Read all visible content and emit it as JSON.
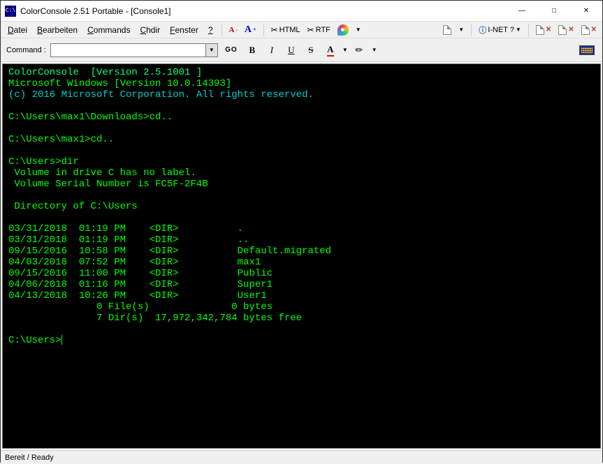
{
  "window": {
    "title": "ColorConsole 2.51 Portable - [Console1]",
    "icon_text": "C:\\"
  },
  "menubar": {
    "items": [
      {
        "label": "Datei",
        "accel": 0
      },
      {
        "label": "Bearbeiten",
        "accel": 0
      },
      {
        "label": "Commands",
        "accel": 0
      },
      {
        "label": "Chdir",
        "accel": 0
      },
      {
        "label": "Fenster",
        "accel": 0
      },
      {
        "label": "?",
        "accel": 0
      }
    ],
    "font_minus": "A",
    "font_plus": "A",
    "html_btn": "HTML",
    "rtf_btn": "RTF",
    "inet_btn": "I-NET ?"
  },
  "toolstrip": {
    "command_label": "Command :",
    "go": "GO",
    "b": "B",
    "i": "I",
    "u": "U",
    "s": "S",
    "a": "A",
    "command_value": ""
  },
  "console": {
    "lines": [
      {
        "c": "hi",
        "t": "ColorConsole  [Version 2.5.1001 ]"
      },
      {
        "c": "",
        "t": "Microsoft Windows [Version 10.0.14393]"
      },
      {
        "c": "cyan",
        "t": "(c) 2016 Microsoft Corporation. All rights reserved."
      },
      {
        "c": "",
        "t": ""
      },
      {
        "c": "",
        "t": "C:\\Users\\max1\\Downloads>cd.."
      },
      {
        "c": "",
        "t": ""
      },
      {
        "c": "",
        "t": "C:\\Users\\max1>cd.."
      },
      {
        "c": "",
        "t": ""
      },
      {
        "c": "",
        "t": "C:\\Users>dir"
      },
      {
        "c": "",
        "t": " Volume in drive C has no label."
      },
      {
        "c": "",
        "t": " Volume Serial Number is FC5F-2F4B"
      },
      {
        "c": "",
        "t": ""
      },
      {
        "c": "",
        "t": " Directory of C:\\Users"
      },
      {
        "c": "",
        "t": ""
      },
      {
        "c": "",
        "t": "03/31/2018  01:19 PM    <DIR>          ."
      },
      {
        "c": "",
        "t": "03/31/2018  01:19 PM    <DIR>          .."
      },
      {
        "c": "",
        "t": "09/15/2016  10:58 PM    <DIR>          Default.migrated"
      },
      {
        "c": "",
        "t": "04/03/2018  07:52 PM    <DIR>          max1"
      },
      {
        "c": "",
        "t": "09/15/2016  11:00 PM    <DIR>          Public"
      },
      {
        "c": "",
        "t": "04/06/2018  01:16 PM    <DIR>          Super1"
      },
      {
        "c": "",
        "t": "04/13/2018  10:26 PM    <DIR>          User1"
      },
      {
        "c": "",
        "t": "               0 File(s)              0 bytes"
      },
      {
        "c": "",
        "t": "               7 Dir(s)  17,972,342,784 bytes free"
      },
      {
        "c": "",
        "t": ""
      }
    ],
    "prompt": "C:\\Users>"
  },
  "statusbar": {
    "text": "Bereit / Ready"
  }
}
